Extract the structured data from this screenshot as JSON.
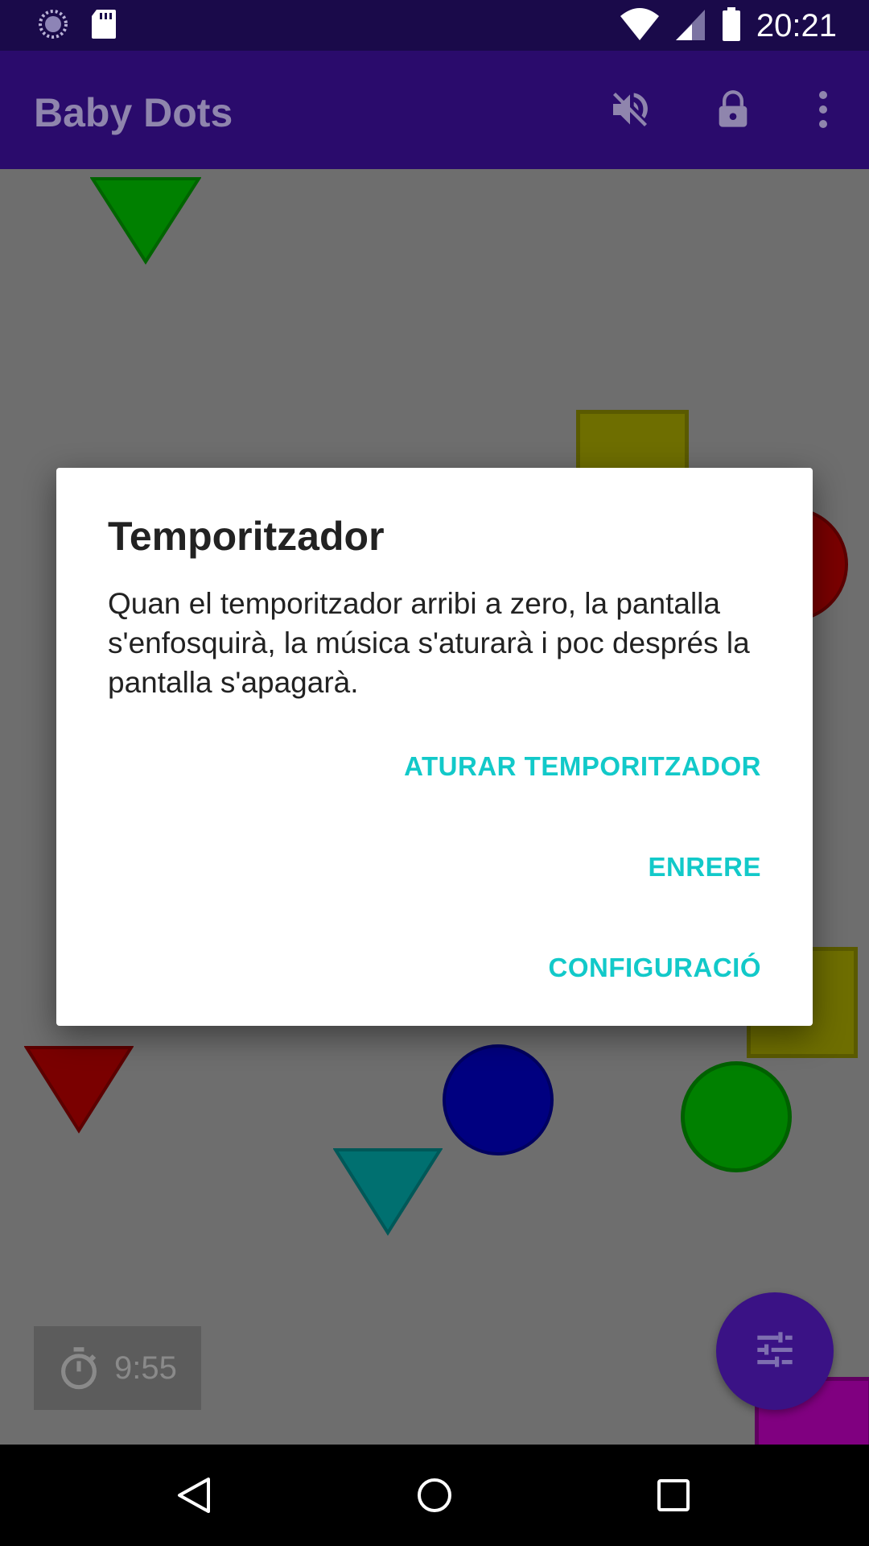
{
  "status_bar": {
    "time": "20:21",
    "icons": [
      "loading-circle-icon",
      "sd-card-icon",
      "wifi-icon",
      "cell-signal-icon",
      "battery-icon"
    ]
  },
  "app_bar": {
    "title": "Baby Dots",
    "actions": [
      "volume-off-icon",
      "lock-icon",
      "overflow-menu-icon"
    ]
  },
  "timer": {
    "value": "9:55",
    "icon": "stopwatch-icon"
  },
  "fab": {
    "icon": "tune-sliders-icon"
  },
  "dialog": {
    "title": "Temporitzador",
    "message": "Quan el temporitzador arribi a zero, la pantalla s'enfosquirà, la música s'aturarà i poc després la pantalla s'apagarà.",
    "buttons": {
      "stop_timer": "ATURAR TEMPORITZADOR",
      "back": "ENRERE",
      "settings": "CONFIGURACIÓ"
    }
  },
  "colors": {
    "accent": "#12c9c9",
    "app_bar": "#2a0b6c",
    "status_bar": "#1a0a4a",
    "canvas_dim": "#6e6e6e"
  },
  "nav_bar": {
    "icons": [
      "back-triangle-icon",
      "home-circle-icon",
      "recents-square-icon"
    ]
  }
}
